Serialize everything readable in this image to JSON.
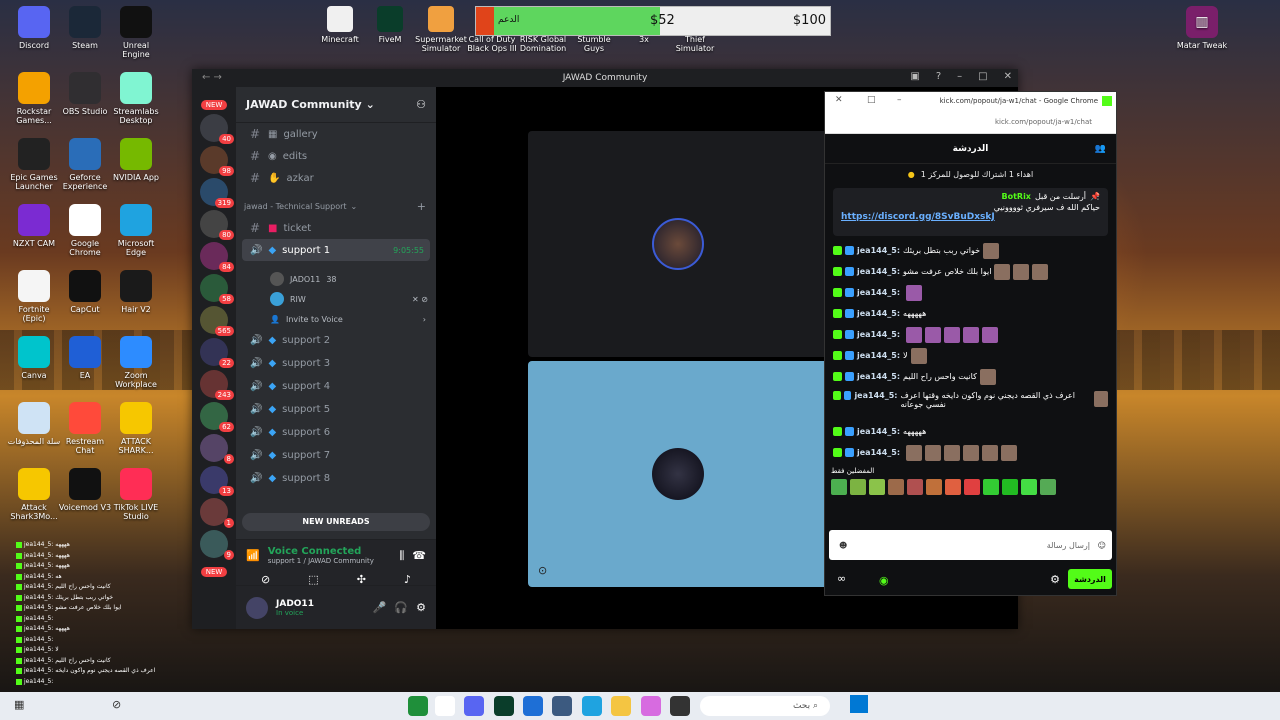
{
  "desktop": {
    "icons_left": [
      {
        "label": "Discord",
        "color": "#5865f2",
        "glyph": "discord-icon"
      },
      {
        "label": "Steam",
        "color": "#1b2838",
        "glyph": "steam-icon"
      },
      {
        "label": "Unreal Engine",
        "color": "#111111",
        "glyph": "unreal-icon"
      },
      {
        "label": "Rockstar Games...",
        "color": "#f4a100",
        "glyph": "rockstar-icon"
      },
      {
        "label": "OBS Studio",
        "color": "#302e31",
        "glyph": "obs-icon"
      },
      {
        "label": "Streamlabs Desktop",
        "color": "#80f5d2",
        "glyph": "streamlabs-icon"
      },
      {
        "label": "Epic Games Launcher",
        "color": "#222222",
        "glyph": "epic-icon"
      },
      {
        "label": "Geforce Experience",
        "color": "#2a6db8",
        "glyph": "geforce-icon"
      },
      {
        "label": "NVIDIA App",
        "color": "#76b900",
        "glyph": "nvidia-icon"
      },
      {
        "label": "NZXT CAM",
        "color": "#7b2bd2",
        "glyph": "nzxt-icon"
      },
      {
        "label": "Google Chrome",
        "color": "#ffffff",
        "glyph": "chrome-icon"
      },
      {
        "label": "Microsoft Edge",
        "color": "#1fa3e0",
        "glyph": "edge-icon"
      },
      {
        "label": "Fortnite (Epic)",
        "color": "#f5f5f5",
        "glyph": "file-icon"
      },
      {
        "label": "CapCut",
        "color": "#111111",
        "glyph": "capcut-icon"
      },
      {
        "label": "Hair V2",
        "color": "#1a1a1a",
        "glyph": "hair-icon"
      },
      {
        "label": "Canva",
        "color": "#00c4cc",
        "glyph": "canva-icon"
      },
      {
        "label": "EA",
        "color": "#1f5fd6",
        "glyph": "ea-icon"
      },
      {
        "label": "Zoom Workplace",
        "color": "#2d8cff",
        "glyph": "zoom-icon"
      },
      {
        "label": "سلة المحذوفات",
        "color": "#cfe3f5",
        "glyph": "recycle-bin-icon"
      },
      {
        "label": "Restream Chat",
        "color": "#ff4a3a",
        "glyph": "restream-icon"
      },
      {
        "label": "ATTACK SHARK...",
        "color": "#f6c700",
        "glyph": "attack-shark-icon"
      },
      {
        "label": "Attack Shark3Mo...",
        "color": "#f6c700",
        "glyph": "attack-shark-icon"
      },
      {
        "label": "Voicemod V3",
        "color": "#111111",
        "glyph": "voicemod-icon"
      },
      {
        "label": "TikTok LIVE Studio",
        "color": "#ff2d55",
        "glyph": "tiktok-icon"
      }
    ],
    "icons_top": [
      {
        "label": "Minecraft"
      },
      {
        "label": "FiveM"
      },
      {
        "label": "Supermarket Simulator"
      },
      {
        "label": "Call of Duty Black Ops III"
      },
      {
        "label": "RISK Global Domination"
      },
      {
        "label": "Stumble Guys"
      },
      {
        "label": "3x"
      },
      {
        "label": "Thief Simulator"
      }
    ],
    "icon_right": {
      "label": "Matar Tweak"
    }
  },
  "donation": {
    "label_goal": "الدعم",
    "current": "$52",
    "target": "$100",
    "progress": 0.52
  },
  "discord": {
    "window_title": "JAWAD Community",
    "server_name": "JAWAD Community",
    "guild_badges": [
      "40",
      "98",
      "319",
      "80",
      "84",
      "58",
      "565",
      "22",
      "243",
      "62",
      "8",
      "13",
      "1",
      "9"
    ],
    "new_label": "NEW",
    "channels_top": [
      {
        "name": "gallery"
      },
      {
        "name": "edits"
      },
      {
        "name": "azkar"
      }
    ],
    "category": "jawad - Technical Support",
    "ticket": "ticket",
    "active_channel": {
      "name": "support 1",
      "timer": "9:05:55"
    },
    "voice_users": [
      {
        "name": "JADO11",
        "extra": "38"
      },
      {
        "name": "RIW",
        "extra": ""
      }
    ],
    "invite": "Invite to Voice",
    "voice_channels": [
      "support 2",
      "support 3",
      "support 4",
      "support 5",
      "support 6",
      "support 7",
      "support 8"
    ],
    "new_unreads": "NEW UNREADS",
    "voice_connected": {
      "status": "Voice Connected",
      "sub": "support 1 / JAWAD Community"
    },
    "user": {
      "name": "JADO11",
      "status": "In voice"
    }
  },
  "kick": {
    "title": "kick.com/popout/ja-w1/chat - Google Chrome",
    "url": "kick.com/popout/ja-w1/chat",
    "header": "الدردشة",
    "top_notice": "اهداء 1 اشتراك للوصول للمركز 1",
    "pinned": {
      "by": "أرسلت من قبل",
      "user": "BotRix",
      "text": "حياكم الله ف سيرفري ثوووونيي",
      "link": "https://discord.gg/8SvBuDxskJ"
    },
    "messages": [
      {
        "user": "jea144_5:",
        "text": "خواتي ربب بتطل بريئك"
      },
      {
        "user": "jea144_5:",
        "text": "ايوا بلك خلاص عرفت مشو"
      },
      {
        "user": "jea144_5:",
        "text": ""
      },
      {
        "user": "jea144_5:",
        "text": "هههههه"
      },
      {
        "user": "jea144_5:",
        "text": ""
      },
      {
        "user": "jea144_5:",
        "text": "لا"
      },
      {
        "user": "jea144_5:",
        "text": "كانيت واحس راح الليم"
      },
      {
        "user": "jea144_5:",
        "text": "اعرف ذي القصه ديجني نوم واكون دايخه وقتها اعرف نفسي جوعانه"
      },
      {
        "user": "jea144_5:",
        "text": "هههههه"
      },
      {
        "user": "jea144_5:",
        "text": ""
      }
    ],
    "emotes_label": "المفضلين فقط",
    "input_placeholder": "إرسال رسالة",
    "send": "الدردشة"
  },
  "mini_chat": [
    "jea144_5: ههههه",
    "jea144_5: ههههه",
    "jea144_5: ههههه",
    "jea144_5: هه",
    "jea144_5: كانيت واحس راح الليم",
    "jea144_5: خواتي ربب بتطل بريئك",
    "jea144_5: ايوا بلك خلاص عرفت مشو",
    "jea144_5:",
    "jea144_5: ههههه",
    "jea144_5:",
    "jea144_5: لا",
    "jea144_5: كانيت واحس راح الليم",
    "jea144_5: اعرف ذي القصه ديجني نوم واكون دايخه",
    "jea144_5:"
  ],
  "taskbar": {
    "search": "بحث"
  }
}
